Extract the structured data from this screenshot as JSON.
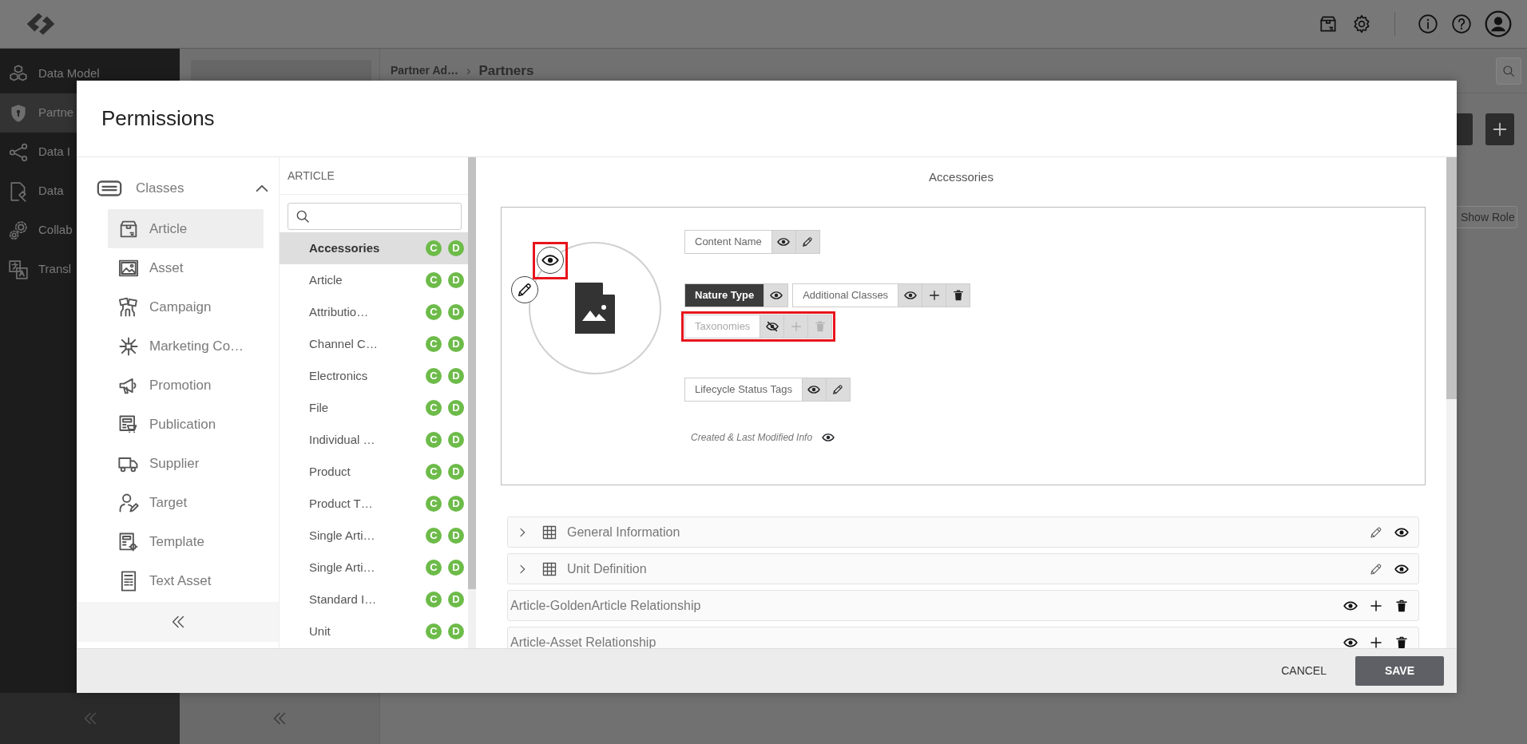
{
  "sidebar": {
    "items": [
      {
        "label": "Data Model",
        "selected": false
      },
      {
        "label": "Partne",
        "selected": true
      },
      {
        "label": "Data I",
        "selected": false
      },
      {
        "label": "Data",
        "selected": false
      },
      {
        "label": "Collab",
        "selected": false
      },
      {
        "label": "Transl",
        "selected": false
      }
    ]
  },
  "breadcrumb": {
    "items": [
      "Partner Ad…",
      "Partners"
    ],
    "separator": "›"
  },
  "toolbar": {
    "show_role_button": "Show Role"
  },
  "modal": {
    "title": "Permissions",
    "classes": {
      "header": "Classes",
      "expanded": true,
      "items": [
        {
          "label": "Article",
          "selected": true
        },
        {
          "label": "Asset",
          "selected": false
        },
        {
          "label": "Campaign",
          "selected": false
        },
        {
          "label": "Marketing Co…",
          "selected": false
        },
        {
          "label": "Promotion",
          "selected": false
        },
        {
          "label": "Publication",
          "selected": false
        },
        {
          "label": "Supplier",
          "selected": false
        },
        {
          "label": "Target",
          "selected": false
        },
        {
          "label": "Template",
          "selected": false
        },
        {
          "label": "Text Asset",
          "selected": false
        }
      ]
    },
    "list": {
      "header": "ARTICLE",
      "items": [
        {
          "label": "Accessories",
          "selected": true,
          "badges": [
            "C",
            "D"
          ]
        },
        {
          "label": "Article",
          "selected": false,
          "badges": [
            "C",
            "D"
          ]
        },
        {
          "label": "Attributio…",
          "selected": false,
          "badges": [
            "C",
            "D"
          ]
        },
        {
          "label": "Channel C…",
          "selected": false,
          "badges": [
            "C",
            "D"
          ]
        },
        {
          "label": "Electronics",
          "selected": false,
          "badges": [
            "C",
            "D"
          ]
        },
        {
          "label": "File",
          "selected": false,
          "badges": [
            "C",
            "D"
          ]
        },
        {
          "label": "Individual …",
          "selected": false,
          "badges": [
            "C",
            "D"
          ]
        },
        {
          "label": "Product",
          "selected": false,
          "badges": [
            "C",
            "D"
          ]
        },
        {
          "label": "Product T…",
          "selected": false,
          "badges": [
            "C",
            "D"
          ]
        },
        {
          "label": "Single Arti…",
          "selected": false,
          "badges": [
            "C",
            "D"
          ]
        },
        {
          "label": "Single Arti…",
          "selected": false,
          "badges": [
            "C",
            "D"
          ]
        },
        {
          "label": "Standard I…",
          "selected": false,
          "badges": [
            "C",
            "D"
          ]
        },
        {
          "label": "Unit",
          "selected": false,
          "badges": [
            "C",
            "D"
          ]
        }
      ]
    },
    "detail": {
      "title": "Accessories",
      "image": {
        "visible": true,
        "highlighted": true
      },
      "field_rows": [
        [
          {
            "kind": "field",
            "label": "Content Name",
            "selected": false,
            "visible": true,
            "disabled": false,
            "highlighted": false,
            "actions": [
              {
                "kind": "view"
              },
              {
                "kind": "edit"
              }
            ]
          }
        ],
        [
          {
            "kind": "field",
            "label": "Nature Type",
            "selected": true,
            "visible": true,
            "disabled": false,
            "highlighted": false,
            "actions": [
              {
                "kind": "view"
              }
            ]
          },
          {
            "kind": "field",
            "label": "Additional Classes",
            "selected": false,
            "visible": true,
            "disabled": false,
            "highlighted": false,
            "actions": [
              {
                "kind": "view"
              },
              {
                "kind": "add"
              },
              {
                "kind": "delete"
              }
            ]
          }
        ],
        [
          {
            "kind": "field",
            "label": "Taxonomies",
            "selected": false,
            "visible": false,
            "disabled": true,
            "highlighted": true,
            "actions": [
              {
                "kind": "view"
              },
              {
                "kind": "add"
              },
              {
                "kind": "delete"
              }
            ]
          }
        ],
        [
          {
            "kind": "field",
            "label": "Lifecycle Status Tags",
            "selected": false,
            "visible": true,
            "disabled": false,
            "highlighted": false,
            "actions": [
              {
                "kind": "view"
              },
              {
                "kind": "edit"
              }
            ]
          }
        ],
        [
          {
            "kind": "info",
            "label": "Created & Last Modified Info",
            "visible": true
          }
        ]
      ],
      "sections": [
        {
          "kind": "group",
          "label": "General Information",
          "expanded": false,
          "actions": [
            {
              "kind": "edit"
            },
            {
              "kind": "view"
            }
          ]
        },
        {
          "kind": "group",
          "label": "Unit Definition",
          "expanded": false,
          "actions": [
            {
              "kind": "edit"
            },
            {
              "kind": "view"
            }
          ]
        },
        {
          "kind": "relationship",
          "label": "Article-GoldenArticle Relationship",
          "actions": [
            {
              "kind": "view"
            },
            {
              "kind": "add"
            },
            {
              "kind": "delete"
            }
          ]
        },
        {
          "kind": "relationship",
          "label": "Article-Asset Relationship",
          "actions": [
            {
              "kind": "view"
            },
            {
              "kind": "add"
            },
            {
              "kind": "delete"
            }
          ]
        }
      ]
    },
    "buttons": [
      {
        "kind": "link",
        "label": "CANCEL"
      },
      {
        "kind": "primary",
        "label": "SAVE"
      }
    ]
  }
}
